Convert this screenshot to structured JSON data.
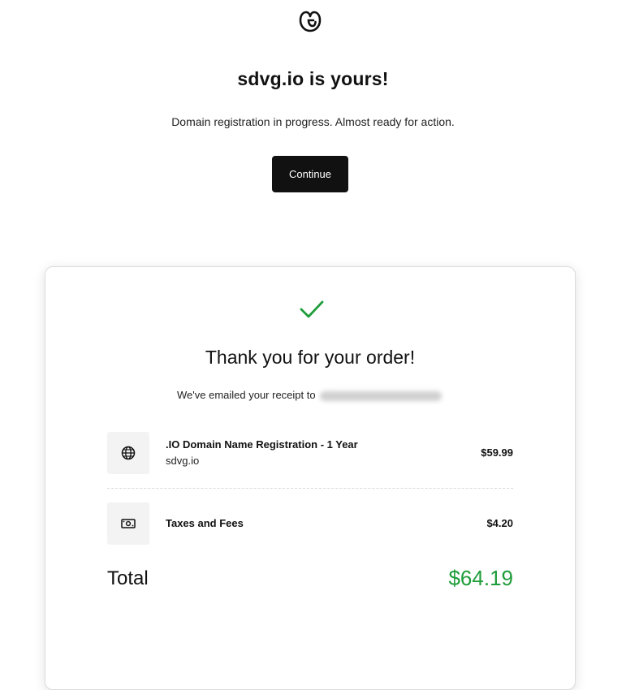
{
  "brand": {
    "logo_icon": "godaddy-logo-icon"
  },
  "header": {
    "title": "sdvg.io is yours!",
    "subtitle": "Domain registration in progress. Almost ready for action.",
    "continue_label": "Continue"
  },
  "order": {
    "check_icon": "checkmark-icon",
    "success_color": "#1f9d3a",
    "title": "Thank you for your order!",
    "receipt_text": "We've emailed your receipt to",
    "items": [
      {
        "icon": "globe-icon",
        "name": ".IO Domain Name Registration - 1 Year",
        "sub": "sdvg.io",
        "price": "$59.99"
      },
      {
        "icon": "money-icon",
        "name": "Taxes and Fees",
        "price": "$4.20"
      }
    ],
    "total_label": "Total",
    "total_value": "$64.19"
  }
}
